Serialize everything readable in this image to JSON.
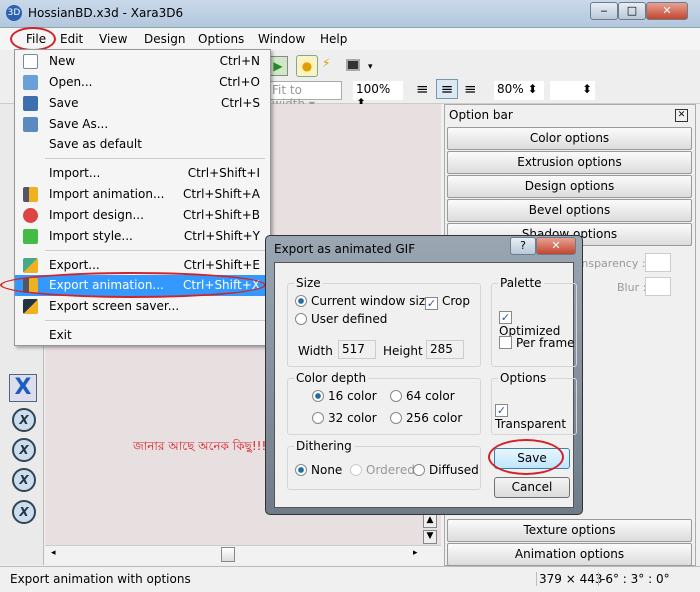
{
  "window": {
    "title": "HossianBD.x3d - Xara3D6",
    "min": "‒",
    "max": "□",
    "close": "✕"
  },
  "menu": [
    "File",
    "Edit",
    "View",
    "Design",
    "Options",
    "Window",
    "Help"
  ],
  "toolbar": {
    "fit": "Fit to width",
    "zoom": "100%",
    "percent": "80%"
  },
  "file_menu": [
    {
      "label": "New",
      "shortcut": "Ctrl+N",
      "icon": "new-file-icon"
    },
    {
      "label": "Open...",
      "shortcut": "Ctrl+O",
      "icon": "open-folder-icon"
    },
    {
      "label": "Save",
      "shortcut": "Ctrl+S",
      "icon": "save-disk-icon"
    },
    {
      "label": "Save As...",
      "shortcut": "",
      "icon": "save-as-icon"
    },
    {
      "label": "Save as default",
      "shortcut": ""
    },
    {
      "label": "Import...",
      "shortcut": "Ctrl+Shift+I"
    },
    {
      "label": "Import animation...",
      "shortcut": "Ctrl+Shift+A",
      "icon": "import-animation-icon"
    },
    {
      "label": "Import design...",
      "shortcut": "Ctrl+Shift+B",
      "icon": "import-design-icon"
    },
    {
      "label": "Import style...",
      "shortcut": "Ctrl+Shift+Y",
      "icon": "import-style-icon"
    },
    {
      "label": "Export...",
      "shortcut": "Ctrl+Shift+E",
      "icon": "export-icon"
    },
    {
      "label": "Export animation...",
      "shortcut": "Ctrl+Shift+X",
      "icon": "export-animation-icon"
    },
    {
      "label": "Export screen saver...",
      "shortcut": "",
      "icon": "export-screensaver-icon"
    },
    {
      "label": "Exit",
      "shortcut": ""
    }
  ],
  "canvas": {
    "text": "জানার আছে অনেক কিছু!!!"
  },
  "panel": {
    "title": "Option bar",
    "buttons": [
      "Color options",
      "Extrusion options",
      "Design options",
      "Bevel options",
      "Shadow options"
    ],
    "transparency": "Transparency :",
    "blur": "Blur :",
    "bottom": [
      "Texture options",
      "Animation options"
    ]
  },
  "dialog": {
    "title": "Export as animated GIF",
    "help": "?",
    "close": "✕",
    "size": {
      "label": "Size",
      "current": "Current window size",
      "user": "User defined",
      "crop": "Crop",
      "width_label": "Width :",
      "width": "517",
      "height_label": "Height :",
      "height": "285"
    },
    "palette": {
      "label": "Palette",
      "optimized": "Optimized",
      "per_frame": "Per frame"
    },
    "depth": {
      "label": "Color depth",
      "c16": "16 color",
      "c64": "64 color",
      "c32": "32 color",
      "c256": "256 color"
    },
    "options": {
      "label": "Options",
      "transparent": "Transparent"
    },
    "dither": {
      "label": "Dithering",
      "none": "None",
      "ordered": "Ordered",
      "diffused": "Diffused"
    },
    "save": "Save",
    "cancel": "Cancel"
  },
  "status": {
    "text": "Export animation with options",
    "size": "379 × 443",
    "angle": "-6° : 3° : 0°"
  },
  "colors": {
    "highlight": "#3399ff",
    "annotation": "#d2232a",
    "canvas": "#e8dfe0"
  }
}
